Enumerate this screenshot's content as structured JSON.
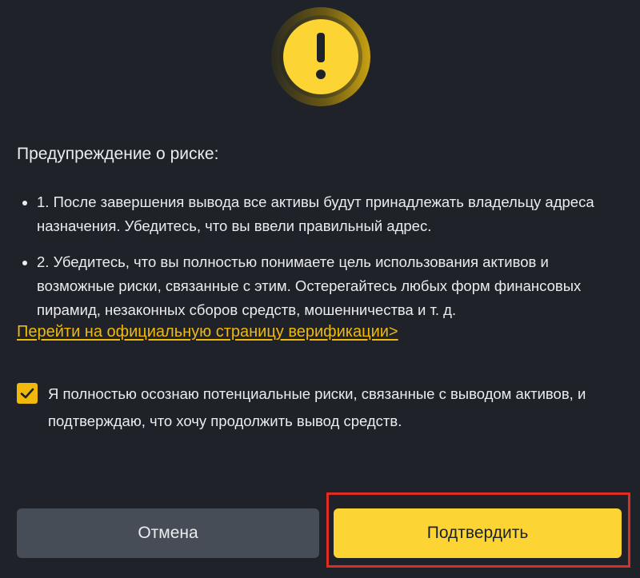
{
  "dialog": {
    "icon": "warning-icon",
    "title": "Предупреждение о риске:",
    "risks": [
      {
        "text": "1. После завершения вывода все активы будут принадлежать владельцу адреса назначения. Убедитесь, что вы ввели правильный адрес."
      },
      {
        "text": "2. Убедитесь, что вы полностью понимаете цель использования активов и возможные риски, связанные с этим. Остерегайтесь любых форм финансовых пирамид, незаконных сборов средств, мошенничества и т. д."
      }
    ],
    "verify_link": "Перейти на официальную страницу верификации>",
    "consent": {
      "checked": true,
      "text": "Я полностью осознаю потенциальные риски, связанные с выводом активов, и подтверждаю, что хочу продолжить вывод средств."
    },
    "buttons": {
      "cancel": "Отмена",
      "confirm": "Подтвердить"
    }
  },
  "colors": {
    "background": "#1f2229",
    "text": "#eaecef",
    "accent": "#fcd535",
    "link": "#f0b90b",
    "cancel_bg": "#474d57",
    "highlight": "#e02d21"
  }
}
